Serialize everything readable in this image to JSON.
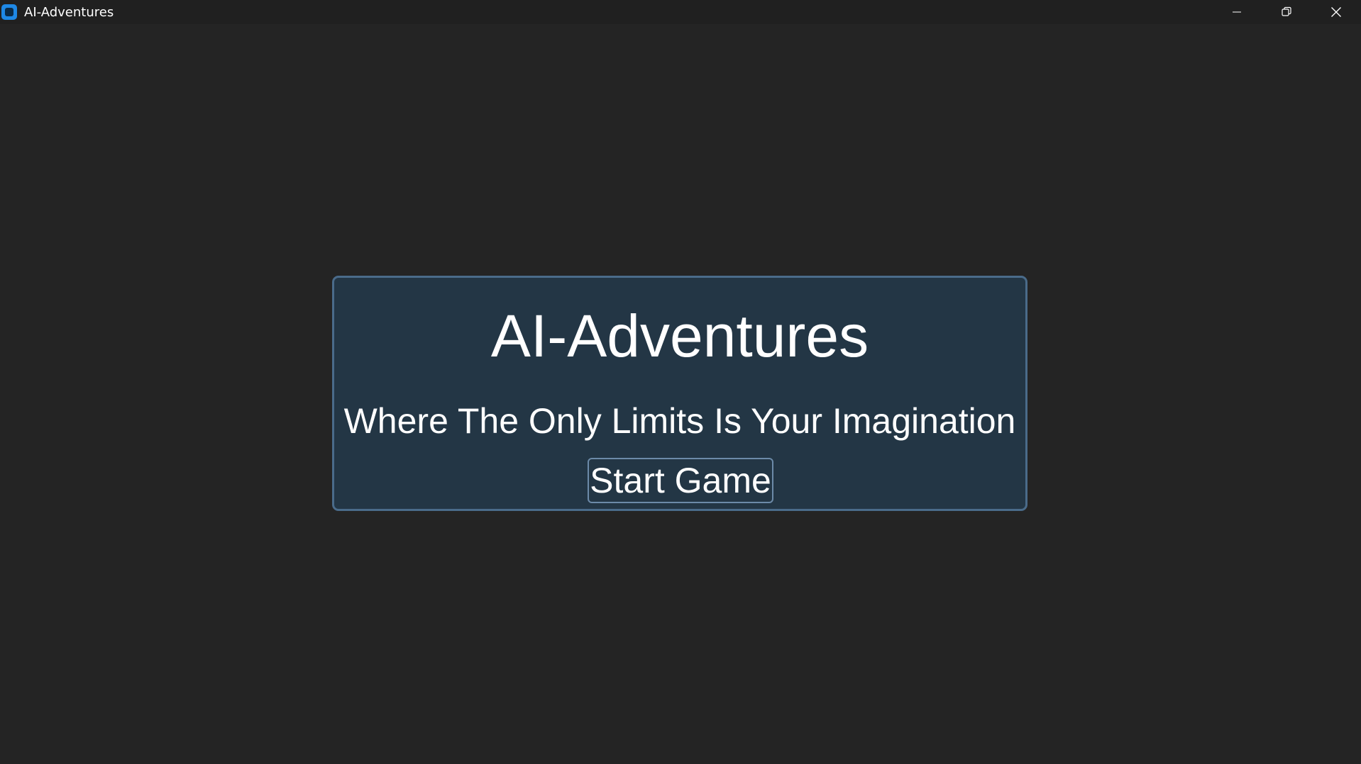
{
  "window": {
    "title": "AI-Adventures",
    "app_icon": "app-icon",
    "controls": {
      "minimize_icon": "minimize-icon",
      "restore_icon": "restore-icon",
      "close_icon": "close-icon"
    }
  },
  "main": {
    "title": "AI-Adventures",
    "tagline": "Where The Only Limits Is Your Imagination",
    "start_button_label": "Start Game"
  },
  "colors": {
    "background": "#242424",
    "titlebar": "#202020",
    "panel_background": "#233645",
    "panel_border": "#4a6b8a",
    "button_border": "#6c8aa8",
    "app_icon_accent": "#1e88e5",
    "text": "#ffffff"
  }
}
